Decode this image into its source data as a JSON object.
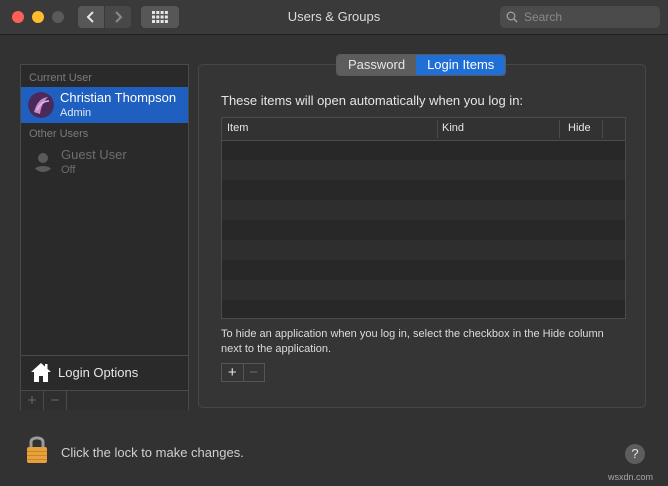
{
  "window": {
    "title": "Users & Groups"
  },
  "search": {
    "placeholder": "Search"
  },
  "sidebar": {
    "current_user_label": "Current User",
    "current_user": {
      "name": "Christian Thompson",
      "role": "Admin"
    },
    "other_users_label": "Other Users",
    "other_user": {
      "name": "Guest User",
      "status": "Off"
    },
    "login_options_label": "Login Options",
    "add_symbol": "+",
    "remove_symbol": "−"
  },
  "tabs": [
    {
      "label": "Password",
      "active": false
    },
    {
      "label": "Login Items",
      "active": true
    }
  ],
  "main": {
    "description": "These items will open automatically when you log in:",
    "columns": [
      "Item",
      "Kind",
      "Hide"
    ],
    "hint": "To hide an application when you log in, select the checkbox in the Hide column next to the application.",
    "add_symbol": "+",
    "remove_symbol": "−"
  },
  "footer": {
    "lock_text": "Click the lock to make changes.",
    "help_symbol": "?"
  },
  "watermark": "wsxdn.com",
  "colors": {
    "accent": "#1f6fd6",
    "selection": "#1f5fbf",
    "close": "#ff5f57",
    "minimize": "#febc2e",
    "lock": "#e8a13a"
  },
  "icons": [
    "back-arrow-icon",
    "forward-arrow-icon",
    "grid-icon",
    "search-icon",
    "avatar-icon",
    "guest-user-icon",
    "house-icon",
    "lock-icon"
  ]
}
